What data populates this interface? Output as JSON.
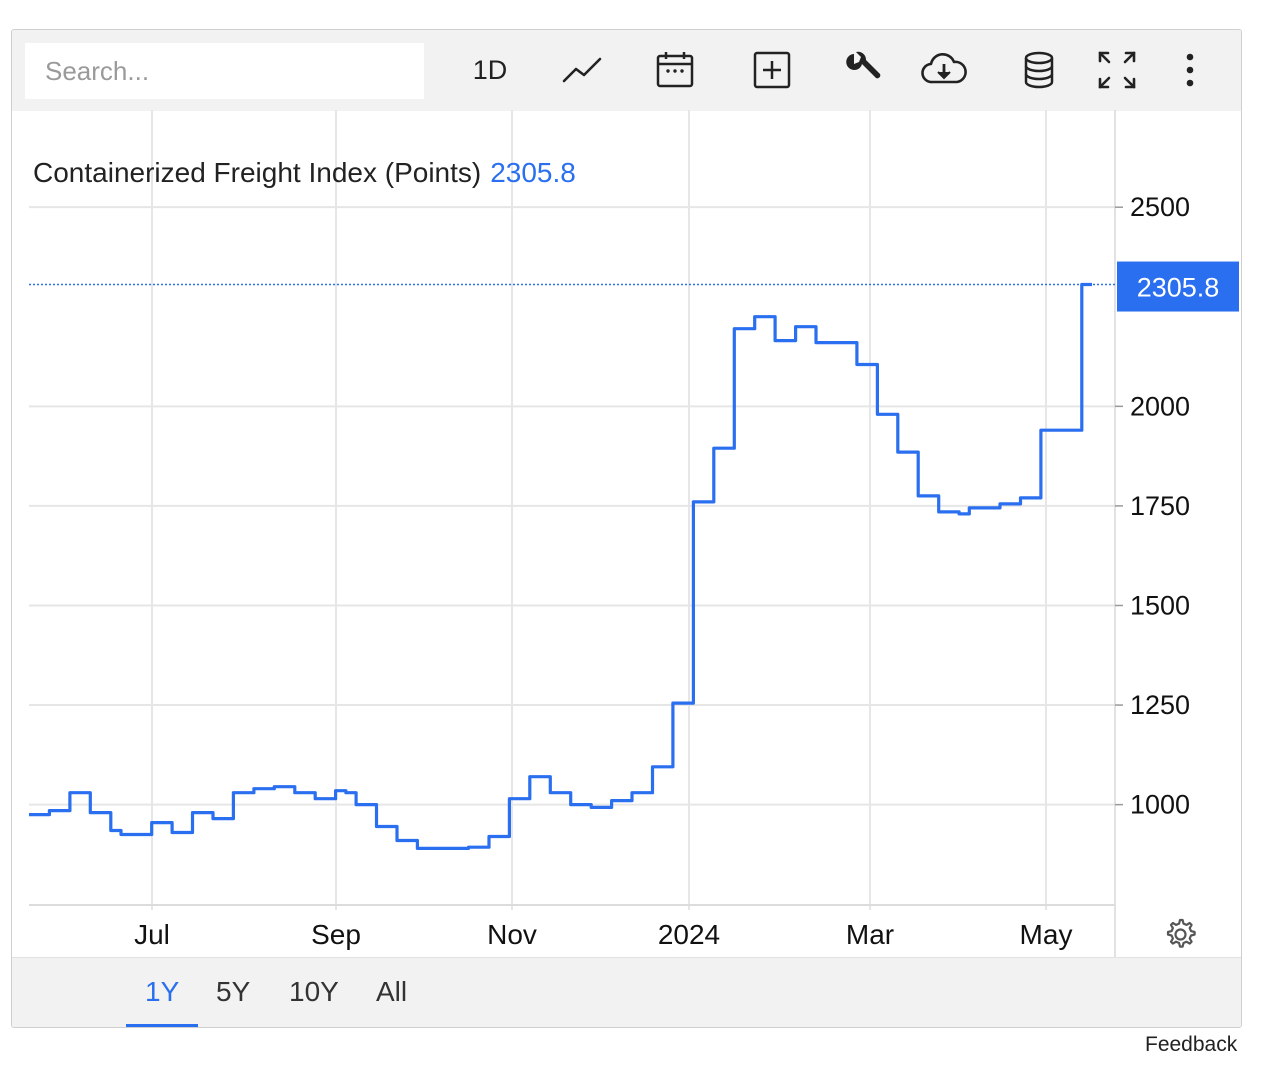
{
  "search": {
    "placeholder": "Search..."
  },
  "toolbar": {
    "interval_label": "1D",
    "icons": [
      "line-chart-icon",
      "calendar-icon",
      "add-icon",
      "wrench-icon",
      "cloud-download-icon",
      "database-icon",
      "fullscreen-icon",
      "more-icon"
    ]
  },
  "header": {
    "title": "Containerized Freight Index (Points)",
    "last_value": "2305.8"
  },
  "ranges": {
    "items": [
      "1Y",
      "5Y",
      "10Y",
      "All"
    ],
    "active": "1Y"
  },
  "feedback_label": "Feedback",
  "colors": {
    "accent": "#2a6fef",
    "grid": "#e6e6e6",
    "toolbar_bg": "#f2f2f2"
  },
  "chart_data": {
    "type": "line",
    "title": "Containerized Freight Index (Points)",
    "xlabel": "",
    "ylabel": "",
    "x_tick_labels": [
      "Jul",
      "Sep",
      "Nov",
      "2024",
      "Mar",
      "May"
    ],
    "y_ticks": [
      1000,
      1250,
      1500,
      1750,
      2000,
      2500
    ],
    "ylim": [
      748,
      2744
    ],
    "grid": true,
    "last_value_label": "2305.8",
    "series": [
      {
        "values": [
          975,
          975,
          985,
          985,
          1030,
          1030,
          980,
          980,
          935,
          925,
          925,
          925,
          955,
          955,
          930,
          930,
          980,
          980,
          965,
          965,
          1030,
          1030,
          1040,
          1040,
          1045,
          1045,
          1030,
          1030,
          1015,
          1015,
          1035,
          1030,
          1000,
          1000,
          945,
          945,
          910,
          910,
          890,
          890,
          890,
          890,
          890,
          893,
          893,
          920,
          920,
          1015,
          1015,
          1070,
          1070,
          1030,
          1030,
          1000,
          1000,
          993,
          993,
          1010,
          1010,
          1030,
          1030,
          1095,
          1095,
          1255,
          1255,
          1760,
          1760,
          1895,
          1895,
          2195,
          2195,
          2225,
          2225,
          2165,
          2165,
          2200,
          2200,
          2160,
          2160,
          2160,
          2160,
          2105,
          2105,
          1980,
          1980,
          1885,
          1885,
          1775,
          1775,
          1735,
          1735,
          1730,
          1745,
          1745,
          1745,
          1755,
          1755,
          1770,
          1770,
          1940,
          1940,
          1940,
          1940,
          2305.8,
          2305.8
        ]
      }
    ]
  }
}
